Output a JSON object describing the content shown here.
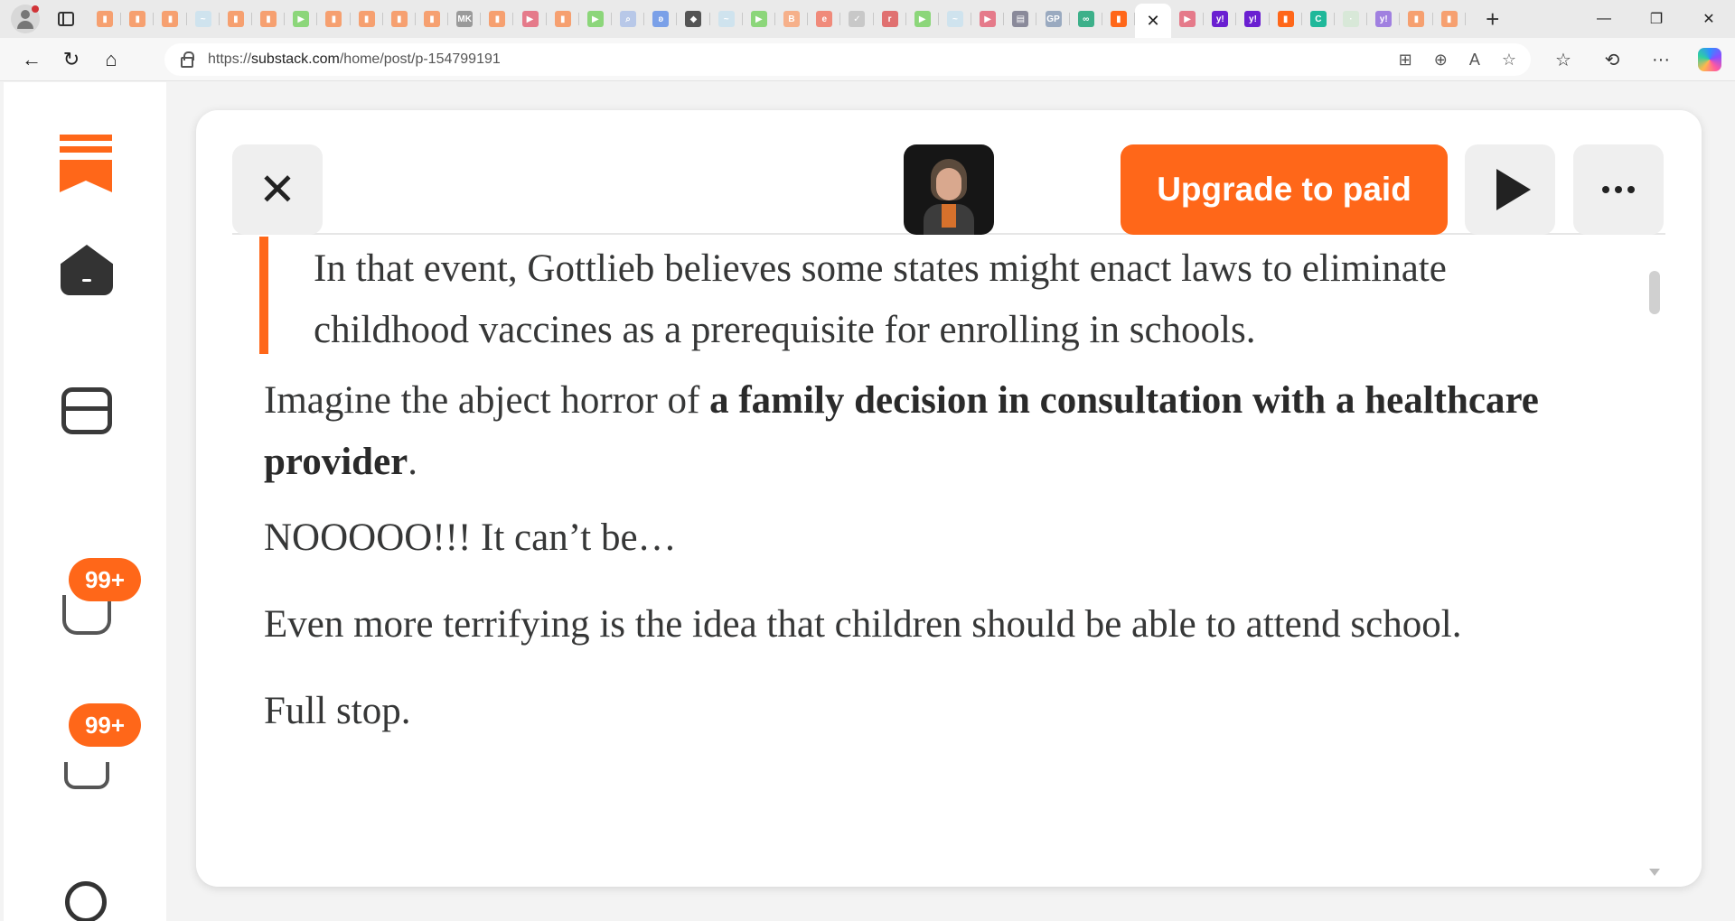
{
  "browser": {
    "tabs": [
      {
        "icon": "substack-favicon",
        "color": "#f6a070",
        "glyph": "▮"
      },
      {
        "icon": "substack-favicon",
        "color": "#f6a070",
        "glyph": "▮"
      },
      {
        "icon": "substack-favicon",
        "color": "#f6a070",
        "glyph": "▮"
      },
      {
        "icon": "wave-favicon",
        "color": "#cfe3ee",
        "glyph": "~"
      },
      {
        "icon": "substack-favicon",
        "color": "#f6a070",
        "glyph": "▮"
      },
      {
        "icon": "substack-favicon",
        "color": "#f6a070",
        "glyph": "▮"
      },
      {
        "icon": "rumble-play-favicon",
        "color": "#8cd67a",
        "glyph": "▶"
      },
      {
        "icon": "substack-favicon",
        "color": "#f6a070",
        "glyph": "▮"
      },
      {
        "icon": "substack-favicon",
        "color": "#f6a070",
        "glyph": "▮"
      },
      {
        "icon": "substack-favicon",
        "color": "#f6a070",
        "glyph": "▮"
      },
      {
        "icon": "substack-favicon",
        "color": "#f6a070",
        "glyph": "▮"
      },
      {
        "icon": "mk-favicon",
        "color": "#9a9a9a",
        "glyph": "MK"
      },
      {
        "icon": "substack-favicon",
        "color": "#f6a070",
        "glyph": "▮"
      },
      {
        "icon": "youtube-favicon",
        "color": "#e57a8a",
        "glyph": "▶"
      },
      {
        "icon": "substack-favicon",
        "color": "#f6a070",
        "glyph": "▮"
      },
      {
        "icon": "rumble-play-favicon",
        "color": "#8cd67a",
        "glyph": "▶"
      },
      {
        "icon": "search-favicon",
        "color": "#b8c8e8",
        "glyph": "⌕"
      },
      {
        "icon": "butterfly-favicon",
        "color": "#7aa0e8",
        "glyph": "ʚ"
      },
      {
        "icon": "diamond-favicon",
        "color": "#555555",
        "glyph": "◆"
      },
      {
        "icon": "wave-favicon",
        "color": "#cfe3ee",
        "glyph": "~"
      },
      {
        "icon": "rumble-play-favicon",
        "color": "#8cd67a",
        "glyph": "▶"
      },
      {
        "icon": "blogger-favicon",
        "color": "#f6b08a",
        "glyph": "B"
      },
      {
        "icon": "e-favicon",
        "color": "#f08a7a",
        "glyph": "e"
      },
      {
        "icon": "bird-favicon",
        "color": "#c8c8c8",
        "glyph": "✓"
      },
      {
        "icon": "r-favicon",
        "color": "#e07070",
        "glyph": "r"
      },
      {
        "icon": "rumble-play-favicon",
        "color": "#8cd67a",
        "glyph": "▶"
      },
      {
        "icon": "wave-favicon",
        "color": "#cfe3ee",
        "glyph": "~"
      },
      {
        "icon": "youtube-favicon",
        "color": "#e57a8a",
        "glyph": "▶"
      },
      {
        "icon": "news-favicon",
        "color": "#8a8a9a",
        "glyph": "▤"
      },
      {
        "icon": "gp-favicon",
        "color": "#9aaac0",
        "glyph": "GP"
      },
      {
        "icon": "tripadvisor-favicon",
        "color": "#3db08a",
        "glyph": "∞"
      },
      {
        "icon": "substack-favicon",
        "color": "#ff6719",
        "glyph": "▮"
      },
      {
        "icon": "close-tab",
        "active": true,
        "glyph": "✕"
      },
      {
        "icon": "youtube-favicon",
        "color": "#e57a8a",
        "glyph": "▶"
      },
      {
        "icon": "yahoo-favicon",
        "color": "#6a1fd1",
        "glyph": "y!"
      },
      {
        "icon": "yahoo-favicon",
        "color": "#6a1fd1",
        "glyph": "y!"
      },
      {
        "icon": "substack-favicon",
        "color": "#ff6719",
        "glyph": "▮"
      },
      {
        "icon": "c-favicon",
        "color": "#1fb89a",
        "glyph": "C"
      },
      {
        "icon": "blank-favicon",
        "color": "#d8e8d8",
        "glyph": "·"
      },
      {
        "icon": "yahoo-favicon",
        "color": "#a080e0",
        "glyph": "y!"
      },
      {
        "icon": "substack-favicon",
        "color": "#f6a070",
        "glyph": "▮"
      },
      {
        "icon": "substack-favicon",
        "color": "#f6a070",
        "glyph": "▮"
      }
    ],
    "new_tab_glyph": "+",
    "window": {
      "minimize": "—",
      "restore": "❐",
      "close": "✕"
    },
    "nav": {
      "back": "←",
      "refresh": "↻",
      "home": "⌂"
    },
    "url_prefix": "https://",
    "url_host": "substack.com",
    "url_path": "/home/post/p-154799191",
    "url_icons": {
      "apps": "⊞",
      "zoom": "⊕",
      "read_aloud": "A",
      "favorite": "☆"
    },
    "right_icons": {
      "favorites": "☆",
      "history": "⟲",
      "more": "···"
    }
  },
  "sidebar": {
    "badges": {
      "chat": "99+",
      "notifications": "99+"
    }
  },
  "reader": {
    "upgrade_label": "Upgrade to paid",
    "close_glyph": "✕"
  },
  "article": {
    "quote": "In that event, Gottlieb believes some states might enact laws to eliminate childhood vaccines as a prerequisite for enrolling in schools.",
    "p1_before": "Imagine the abject horror of ",
    "p1_bold": "a family decision in consultation with a healthcare provider",
    "p1_after": ".",
    "p2": "NOOOOO!!! It can’t be…",
    "p3": "Even more terrifying is the idea that children should be able to attend school.",
    "p4": "Full stop."
  },
  "colors": {
    "accent": "#ff6719"
  }
}
